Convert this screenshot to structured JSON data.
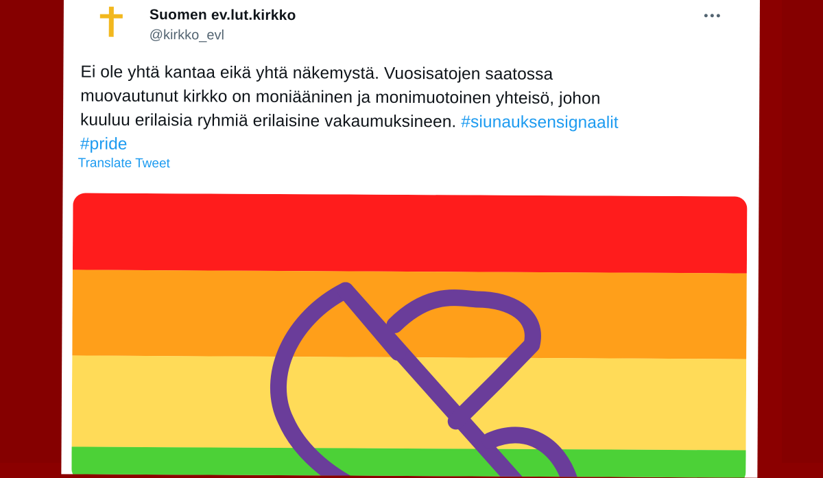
{
  "account": {
    "display_name": "Suomen ev.lut.kirkko",
    "handle": "@kirkko_evl",
    "avatar_icon": "golden-cross-icon"
  },
  "tweet": {
    "lines": [
      "Ei ole yhtä kantaa eikä yhtä näkemystä. Vuosisatojen saatossa",
      "muovautunut kirkko on moniääninen ja monimuotoinen yhteisö, johon",
      "kuuluu erilaisia ryhmiä erilaisine vakaumuksineen. "
    ],
    "hashtags": [
      "#siunauksensignaalit",
      "#pride"
    ],
    "translate_label": "Translate Tweet"
  },
  "media": {
    "stripe_colors": [
      "#ff1c1c",
      "#ff9f1a",
      "#ffdb58",
      "#4cd137"
    ],
    "logo_color": "#6a3d9a",
    "logo_icon": "heart-symbol-icon"
  },
  "colors": {
    "backdrop": "#8b0000",
    "link": "#1d9bf0",
    "text": "#0f1419"
  }
}
